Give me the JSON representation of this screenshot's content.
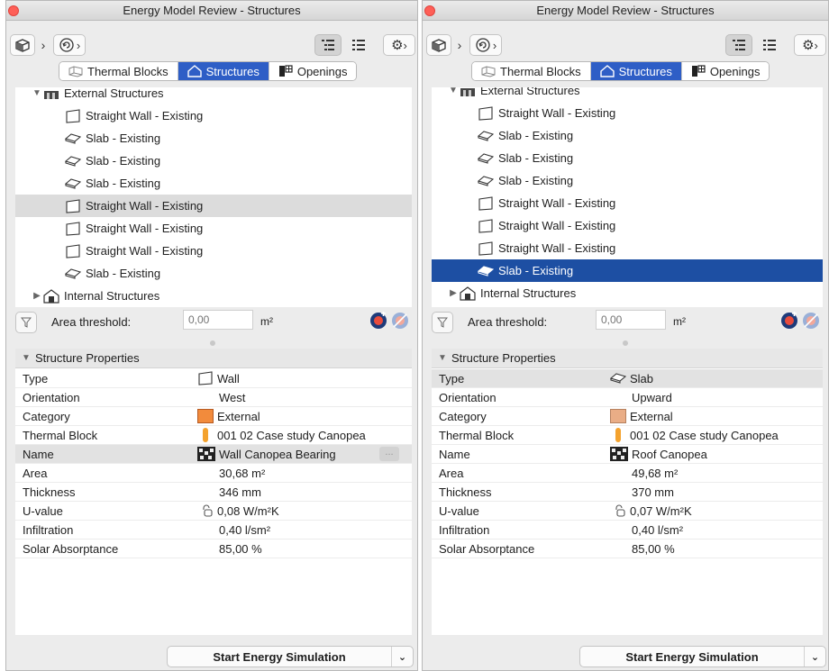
{
  "colors": {
    "accent_blue": "#2e5ec6",
    "selection_blue": "#1d4fa3",
    "category_external_left": "#f28b3c",
    "category_external_right": "#e9ad86",
    "thermal_block_orange": "#f4a22d",
    "close_red": "#fe5f57"
  },
  "left": {
    "title": "Energy Model Review - Structures",
    "tabs": [
      {
        "label": "Thermal Blocks",
        "icon": "thermal-blocks-icon",
        "active": false
      },
      {
        "label": "Structures",
        "icon": "structures-house-icon",
        "active": true
      },
      {
        "label": "Openings",
        "icon": "openings-icon",
        "active": false
      }
    ],
    "tree": {
      "external_label": "External Structures",
      "internal_label": "Internal Structures",
      "items": [
        {
          "label": "Straight Wall - Existing",
          "kind": "wall-icon"
        },
        {
          "label": "Slab - Existing",
          "kind": "slab-icon"
        },
        {
          "label": "Slab - Existing",
          "kind": "slab-icon"
        },
        {
          "label": "Slab - Existing",
          "kind": "slab-icon"
        },
        {
          "label": "Straight Wall - Existing",
          "kind": "wall-icon"
        },
        {
          "label": "Straight Wall - Existing",
          "kind": "wall-icon"
        },
        {
          "label": "Straight Wall - Existing",
          "kind": "wall-icon"
        },
        {
          "label": "Slab - Existing",
          "kind": "slab-icon"
        }
      ]
    },
    "threshold": {
      "label": "Area threshold:",
      "placeholder": "0,00",
      "unit": "m²"
    },
    "props": {
      "header": "Structure Properties",
      "rows": [
        {
          "key": "Type",
          "value": "Wall"
        },
        {
          "key": "Orientation",
          "value": "West"
        },
        {
          "key": "Category",
          "value": "External"
        },
        {
          "key": "Thermal Block",
          "value": "001 02 Case study Canopea"
        },
        {
          "key": "Name",
          "value": "Wall Canopea Bearing"
        },
        {
          "key": "Area",
          "value": "30,68 m²"
        },
        {
          "key": "Thickness",
          "value": "346 mm"
        },
        {
          "key": "U-value",
          "value": "0,08 W/m²K"
        },
        {
          "key": "Infiltration",
          "value": "0,40 l/sm²"
        },
        {
          "key": "Solar Absorptance",
          "value": "85,00 %"
        }
      ],
      "ellipsis": "..."
    },
    "simulate_label": "Start Energy Simulation"
  },
  "right": {
    "title": "Energy Model Review - Structures",
    "tabs": [
      {
        "label": "Thermal Blocks",
        "icon": "thermal-blocks-icon",
        "active": false
      },
      {
        "label": "Structures",
        "icon": "structures-house-icon",
        "active": true
      },
      {
        "label": "Openings",
        "icon": "openings-icon",
        "active": false
      }
    ],
    "tree": {
      "external_label": "External Structures",
      "internal_label": "Internal Structures",
      "items": [
        {
          "label": "Straight Wall - Existing",
          "kind": "wall-icon"
        },
        {
          "label": "Slab - Existing",
          "kind": "slab-icon"
        },
        {
          "label": "Slab - Existing",
          "kind": "slab-icon"
        },
        {
          "label": "Slab - Existing",
          "kind": "slab-icon"
        },
        {
          "label": "Straight Wall - Existing",
          "kind": "wall-icon"
        },
        {
          "label": "Straight Wall - Existing",
          "kind": "wall-icon"
        },
        {
          "label": "Straight Wall - Existing",
          "kind": "wall-icon"
        },
        {
          "label": "Slab - Existing",
          "kind": "slab-icon"
        }
      ]
    },
    "threshold": {
      "label": "Area threshold:",
      "placeholder": "0,00",
      "unit": "m²"
    },
    "props": {
      "header": "Structure Properties",
      "rows": [
        {
          "key": "Type",
          "value": "Slab"
        },
        {
          "key": "Orientation",
          "value": "Upward"
        },
        {
          "key": "Category",
          "value": "External"
        },
        {
          "key": "Thermal Block",
          "value": "001 02 Case study Canopea"
        },
        {
          "key": "Name",
          "value": "Roof Canopea"
        },
        {
          "key": "Area",
          "value": "49,68 m²"
        },
        {
          "key": "Thickness",
          "value": "370 mm"
        },
        {
          "key": "U-value",
          "value": "0,07 W/m²K"
        },
        {
          "key": "Infiltration",
          "value": "0,40 l/sm²"
        },
        {
          "key": "Solar Absorptance",
          "value": "85,00 %"
        }
      ]
    },
    "simulate_label": "Start Energy Simulation"
  }
}
